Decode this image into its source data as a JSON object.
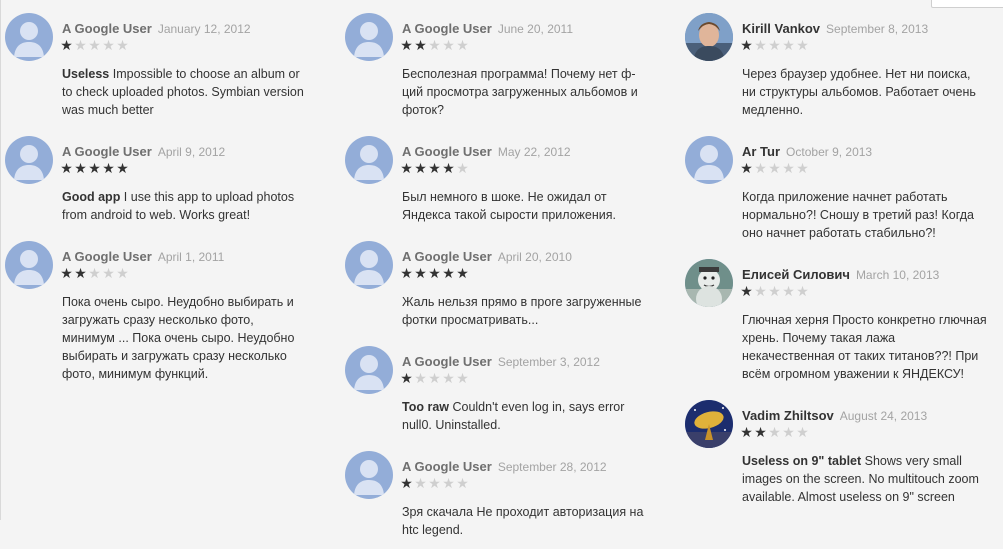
{
  "reviews": [
    {
      "author": "A Google User",
      "date": "January 12, 2012",
      "rating": 1,
      "title": "Useless",
      "text": " Impossible to choose an album or to check uploaded photos. Symbian version was much better",
      "avatar": "default-avatar-icon"
    },
    {
      "author": "A Google User",
      "date": "April 9, 2012",
      "rating": 5,
      "title": "Good app",
      "text": " I use this app to upload photos from android to web. Works great!",
      "avatar": "default-avatar-icon"
    },
    {
      "author": "A Google User",
      "date": "April 1, 2011",
      "rating": 2,
      "title": "",
      "text": "Пока очень сыро. Неудобно выбирать и загружать сразу несколько фото, минимум ... Пока очень сыро. Неудобно выбирать и загружать сразу несколько фото, минимум функций.",
      "avatar": "default-avatar-icon"
    },
    {
      "author": "A Google User",
      "date": "June 20, 2011",
      "rating": 2,
      "title": "",
      "text": "Бесполезная программа! Почему нет ф-ций просмотра загруженных альбомов и фоток?",
      "avatar": "default-avatar-icon"
    },
    {
      "author": "A Google User",
      "date": "May 22, 2012",
      "rating": 4,
      "title": "",
      "text": "Был немного в шоке. Не ожидал от Яндекса такой сырости приложения.",
      "avatar": "default-avatar-icon"
    },
    {
      "author": "A Google User",
      "date": "April 20, 2010",
      "rating": 5,
      "title": "",
      "text": "Жаль нельзя прямо в проге загруженные фотки просматривать...",
      "avatar": "default-avatar-icon"
    },
    {
      "author": "A Google User",
      "date": "September 3, 2012",
      "rating": 1,
      "title": "Too raw",
      "text": " Couldn't even log in, says error null0. Uninstalled.",
      "avatar": "default-avatar-icon"
    },
    {
      "author": "A Google User",
      "date": "September 28, 2012",
      "rating": 1,
      "title": "",
      "text": "Зря скачала Не проходит авторизация на htc legend.",
      "avatar": "default-avatar-icon"
    },
    {
      "author": "Kirill Vankov",
      "date": "September 8, 2013",
      "rating": 1,
      "title": "",
      "text": "Через браузер удобнее. Нет ни поиска, ни структуры альбомов. Работает очень медленно.",
      "avatar": "user-photo-avatar-icon"
    },
    {
      "author": "Ar Tur",
      "date": "October 9, 2013",
      "rating": 1,
      "title": "",
      "text": "Когда приложение начнет работать нормально?! Сношу в третий раз! Когда оно начнет работать стабильно?!",
      "avatar": "default-avatar-icon"
    },
    {
      "author": "Елисей Силович",
      "date": "March 10, 2013",
      "rating": 1,
      "title": "",
      "text": "Глючная херня Просто конкретно глючная хрень. Почему такая лажа некачественная от таких титанов??! При всём огромном уважении к ЯНДЕКСУ!",
      "avatar": "snowman-avatar-icon"
    },
    {
      "author": "Vadim Zhiltsov",
      "date": "August 24, 2013",
      "rating": 2,
      "title": "Useless on 9\" tablet",
      "text": " Shows very small images on the screen. No multitouch zoom available. Almost useless on 9\" screen",
      "avatar": "satellite-dish-avatar-icon"
    }
  ]
}
